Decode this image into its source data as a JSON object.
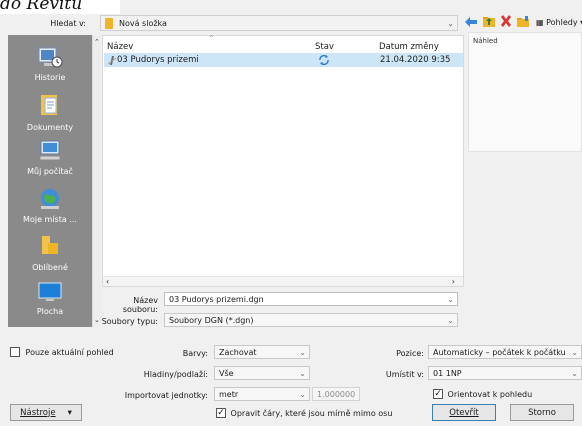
{
  "caption": "do Revitu",
  "lookin": {
    "label": "Hledat v:",
    "value": "Nová složka"
  },
  "toolbar": {
    "views_label": "Pohledy"
  },
  "places": [
    {
      "label": "Historie",
      "icon": "history-icon"
    },
    {
      "label": "Dokumenty",
      "icon": "documents-icon"
    },
    {
      "label": "Můj počítač",
      "icon": "computer-icon"
    },
    {
      "label": "Moje místa ...",
      "icon": "network-places-icon"
    },
    {
      "label": "Oblíbené",
      "icon": "favorites-icon"
    },
    {
      "label": "Plocha",
      "icon": "desktop-icon"
    }
  ],
  "file_list": {
    "columns": [
      "Název",
      "Stav",
      "Datum změny"
    ],
    "rows": [
      {
        "name": "03 Pudorys prizemi",
        "date": "21.04.2020 9:35"
      }
    ]
  },
  "preview": {
    "label": "Náhled"
  },
  "filename": {
    "label": "Název souboru:",
    "value": "03 Pudorys prizemi.dgn"
  },
  "filetype": {
    "label": "Soubory typu:",
    "value": "Soubory DGN  (*.dgn)"
  },
  "options": {
    "current_view_only": "Pouze aktuální pohled",
    "colors_label": "Barvy:",
    "colors_value": "Zachovat",
    "layers_label": "Hladiny/podlaží:",
    "layers_value": "Vše",
    "units_label": "Importovat jednotky:",
    "units_value": "metr",
    "units_factor": "1.000000",
    "correct_lines": "Opravit čáry, které jsou mírně mimo osu",
    "position_label": "Pozice:",
    "position_value": "Automaticky – počátek k počátku",
    "place_at_label": "Umístit v:",
    "place_at_value": "01 1NP",
    "orient_to_view": "Orientovat k pohledu"
  },
  "buttons": {
    "tools": "Nástroje",
    "open": "Otevřít",
    "cancel": "Storno"
  },
  "colors": {
    "places_bg": "#8a8a8a",
    "selection": "#cde6f7",
    "folder": "#f0b428"
  }
}
